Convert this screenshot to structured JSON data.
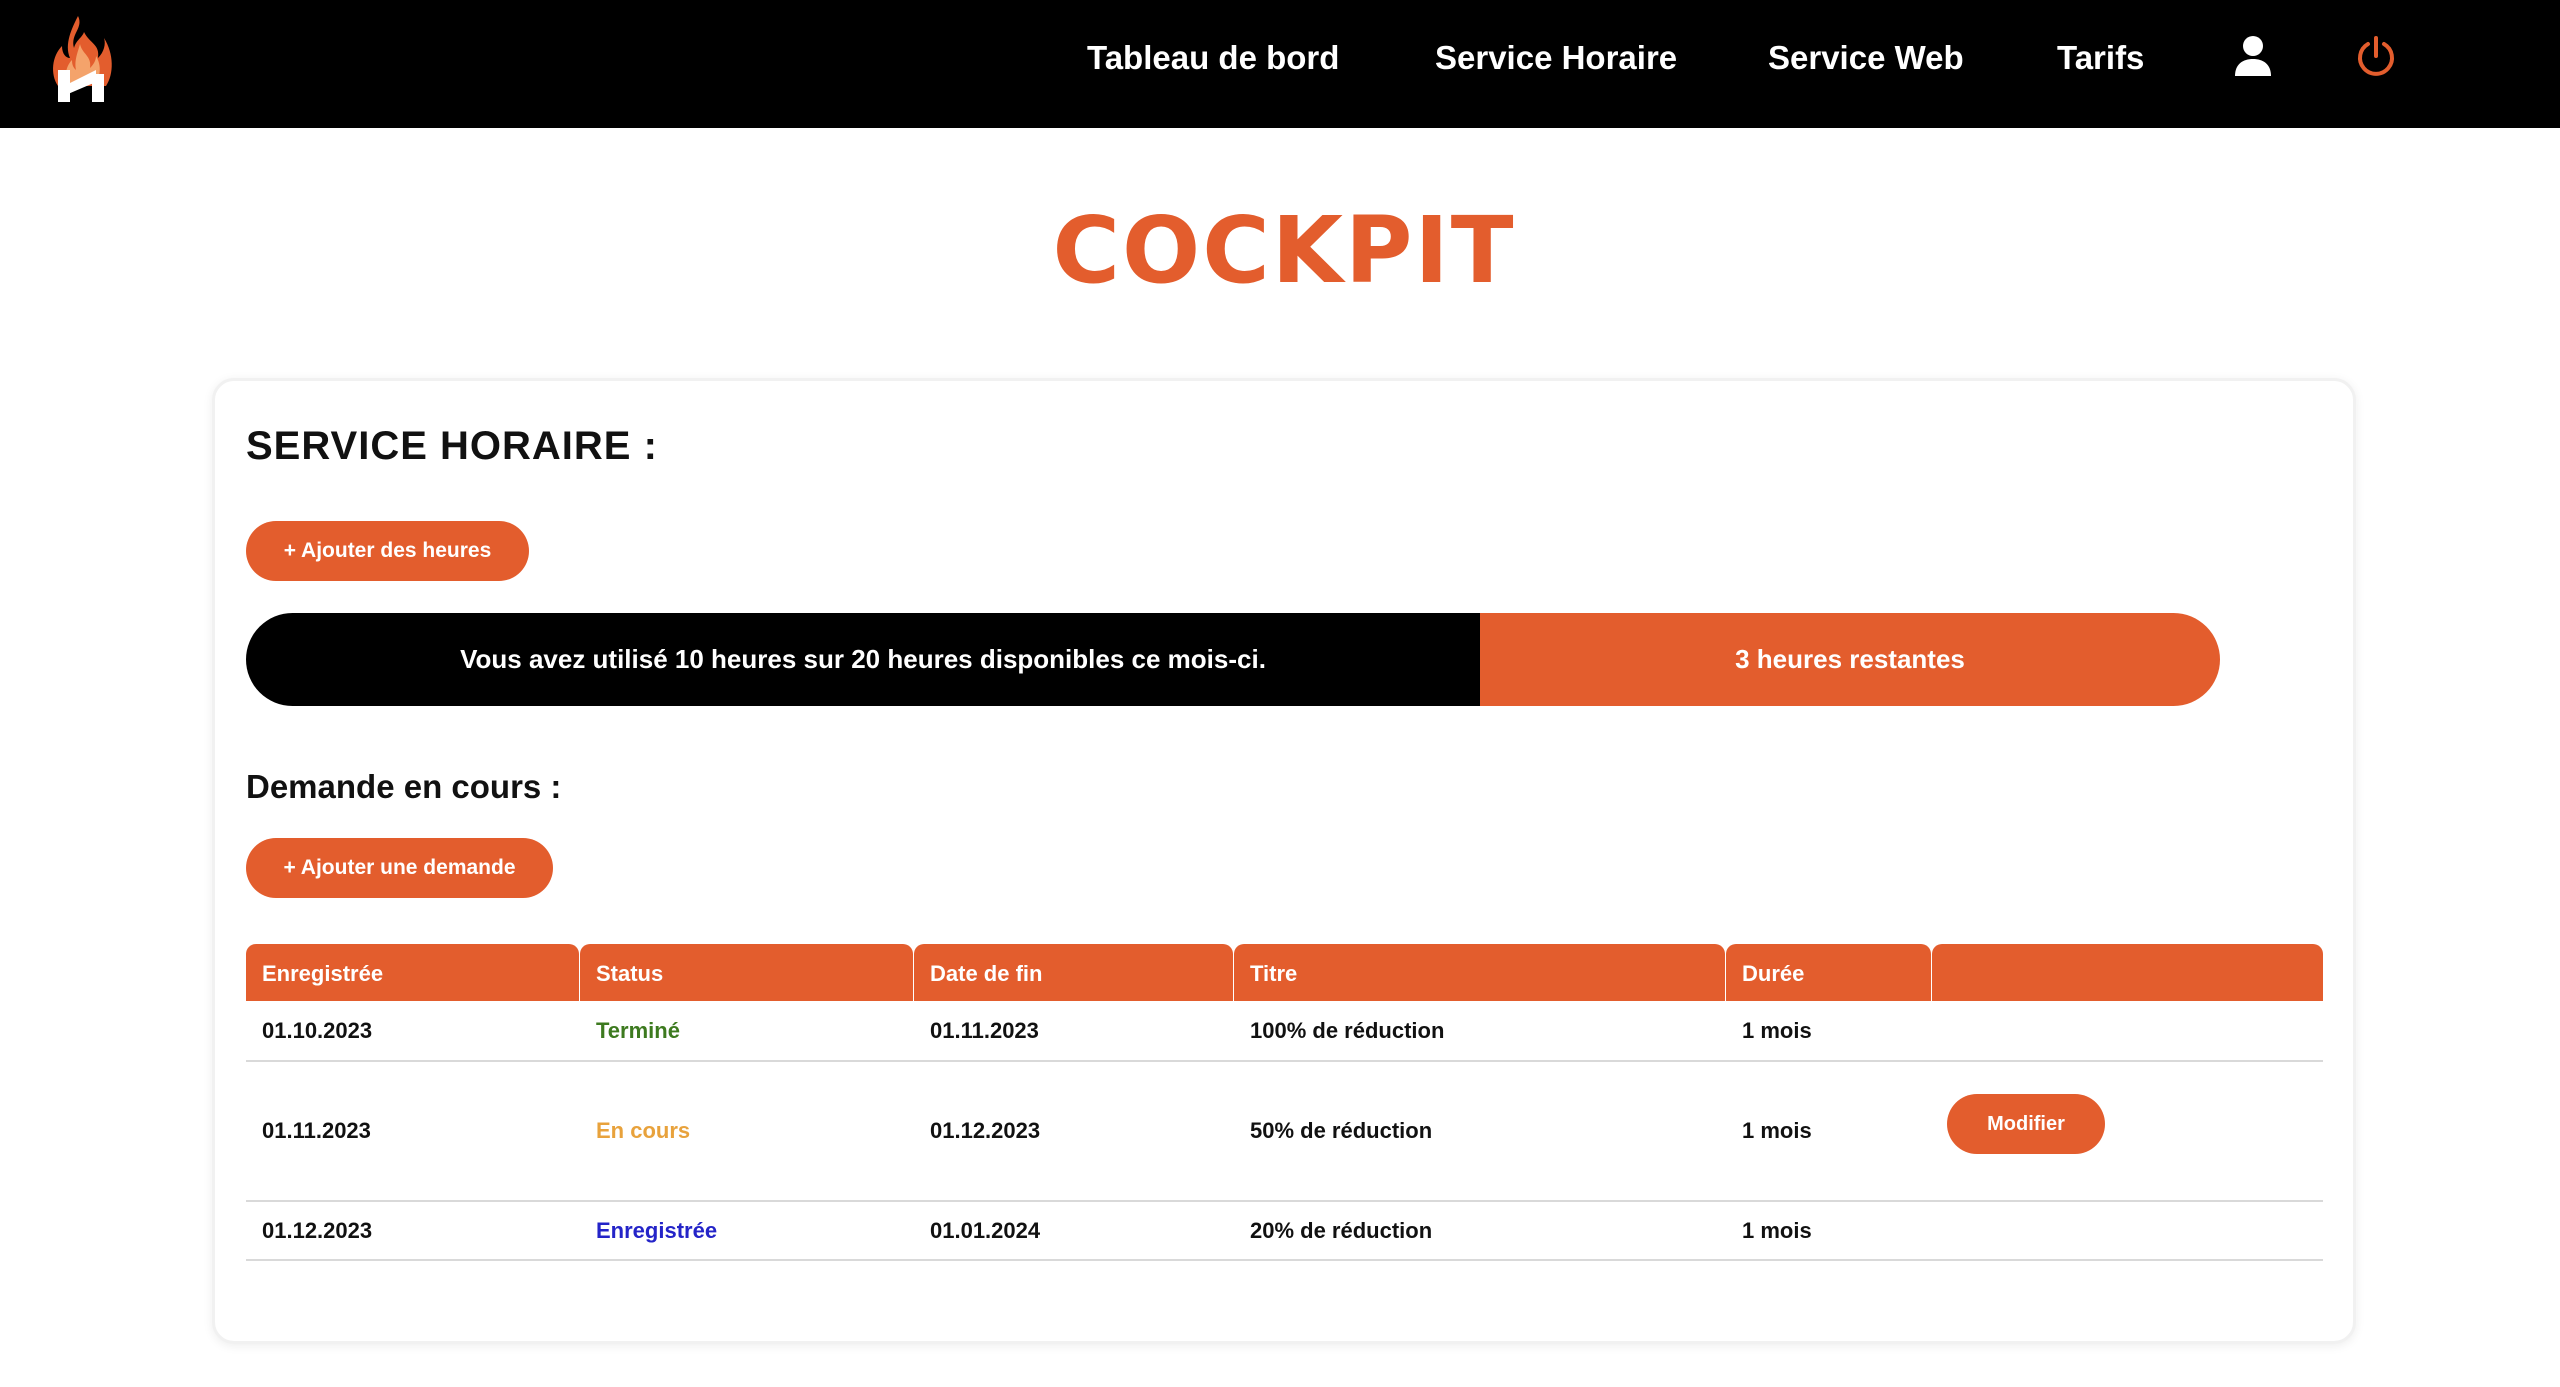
{
  "header": {
    "logo_icon": "flame-h-logo-icon",
    "nav": [
      {
        "label": "Tableau de bord"
      },
      {
        "label": "Service Horaire"
      },
      {
        "label": "Service Web"
      },
      {
        "label": "Tarifs"
      }
    ],
    "user_icon": "user-icon",
    "power_icon": "power-icon"
  },
  "page": {
    "title": "COCKPIT"
  },
  "service_horaire": {
    "title": "SERVICE HORAIRE :",
    "add_hours_label": "+ Ajouter des heures",
    "usage": {
      "used_text": "Vous avez utilisé 10 heures sur 20 heures disponibles ce mois-ci.",
      "remaining_text": "3 heures restantes"
    },
    "requests": {
      "title": "Demande en cours :",
      "add_request_label": "+ Ajouter une demande",
      "columns": [
        "Enregistrée",
        "Status",
        "Date de fin",
        "Titre",
        "Durée",
        ""
      ],
      "rows": [
        {
          "registered": "01.10.2023",
          "status": "Terminé",
          "end_date": "01.11.2023",
          "title": "100% de réduction",
          "duration": "1 mois",
          "action": ""
        },
        {
          "registered": "01.11.2023",
          "status": "En cours",
          "end_date": "01.12.2023",
          "title": "50% de réduction",
          "duration": "1 mois",
          "action": "Modifier"
        },
        {
          "registered": "01.12.2023",
          "status": "Enregistrée",
          "end_date": "01.01.2024",
          "title": "20% de réduction",
          "duration": "1 mois",
          "action": ""
        }
      ]
    }
  },
  "colors": {
    "accent": "#E35D2D",
    "header_bg": "#000000",
    "status_done": "#3d7a1f",
    "status_in_progress": "#E8A23C",
    "status_registered": "#2424c8"
  }
}
